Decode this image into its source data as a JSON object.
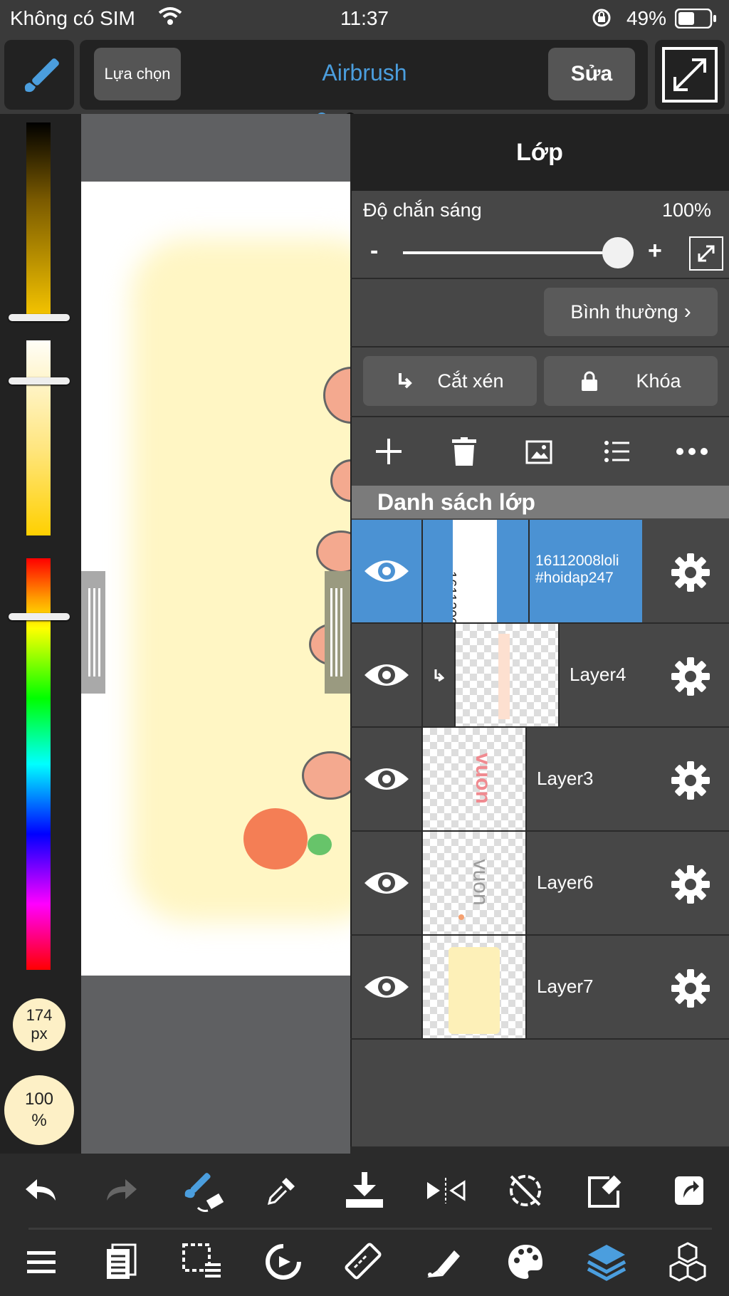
{
  "status_bar": {
    "carrier": "Không có SIM",
    "time": "11:37",
    "battery": "49%"
  },
  "toolbar": {
    "select_label": "Lựa chọn",
    "tool_name": "Airbrush",
    "edit_label": "Sửa"
  },
  "brush": {
    "size": "174",
    "size_unit": "px",
    "opacity": "100",
    "opacity_unit": "%"
  },
  "layer_panel": {
    "title": "Lớp",
    "opacity_label": "Độ chắn sáng",
    "opacity_value": "100%",
    "opacity_level": 1.0,
    "minus": "-",
    "plus": "+",
    "blend_mode": "Bình thường",
    "clipping_label": "Cắt xén",
    "lock_label": "Khóa",
    "list_header": "Danh sách lớp",
    "layers": [
      {
        "name_line1": "16112008loli",
        "name_line2": "#hoidap247",
        "thumb_text": "16112008loli #hoidap247",
        "selected": true
      },
      {
        "name": "Layer4",
        "clipped": true
      },
      {
        "name": "Layer3",
        "thumb_text": "vuon"
      },
      {
        "name": "Layer6",
        "thumb_text": "vuon"
      },
      {
        "name": "Layer7"
      }
    ]
  },
  "colors": {
    "accent": "#4b9ede",
    "selected_row": "#4b92d3",
    "panel": "#474747",
    "dark": "#222222"
  }
}
